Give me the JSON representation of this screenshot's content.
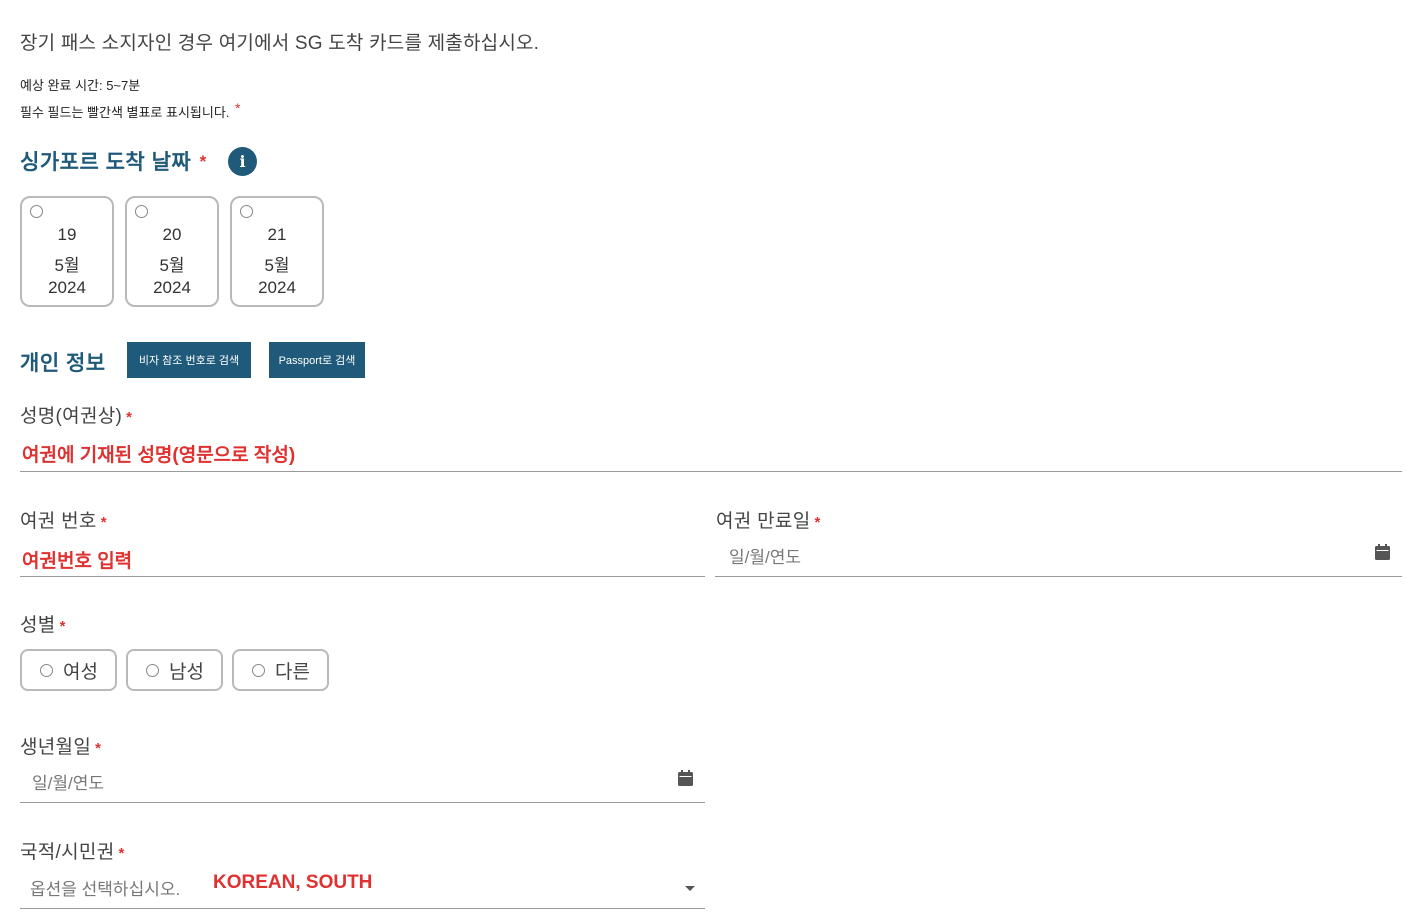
{
  "intro": {
    "heading": "장기 패스 소지자인 경우 여기에서 SG 도착 카드를 제출하십시오.",
    "estimated_time": "예상 완료 시간: 5~7분",
    "required_note": "필수 필드는 빨간색 별표로 표시됩니다.",
    "asterisk": "*"
  },
  "arrival": {
    "title": "싱가포르 도착 날짜",
    "info_icon": "info-icon",
    "dates": [
      {
        "day": "19",
        "month": "5월",
        "year": "2024"
      },
      {
        "day": "20",
        "month": "5월",
        "year": "2024"
      },
      {
        "day": "21",
        "month": "5월",
        "year": "2024"
      }
    ]
  },
  "personal": {
    "title": "개인 정보",
    "search_visa_label": "비자 참조 번호로 검색",
    "search_passport_label": "Passport로 검색"
  },
  "fields": {
    "name_label": "성명(여권상)",
    "name_value": "여권에 기재된 성명(영문으로 작성)",
    "passport_no_label": "여권 번호",
    "passport_no_value": "여권번호 입력",
    "passport_expiry_label": "여권 만료일",
    "passport_expiry_placeholder": "일/월/연도",
    "sex_label": "성별",
    "sex_options": [
      "여성",
      "남성",
      "다른"
    ],
    "dob_label": "생년월일",
    "dob_placeholder": "일/월/연도",
    "nationality_label": "국적/시민권",
    "nationality_placeholder": "옵션을 선택하십시오.",
    "nationality_value": "KOREAN, SOUTH"
  },
  "colors": {
    "accent": "#1f5a7a",
    "required": "#e03131"
  }
}
